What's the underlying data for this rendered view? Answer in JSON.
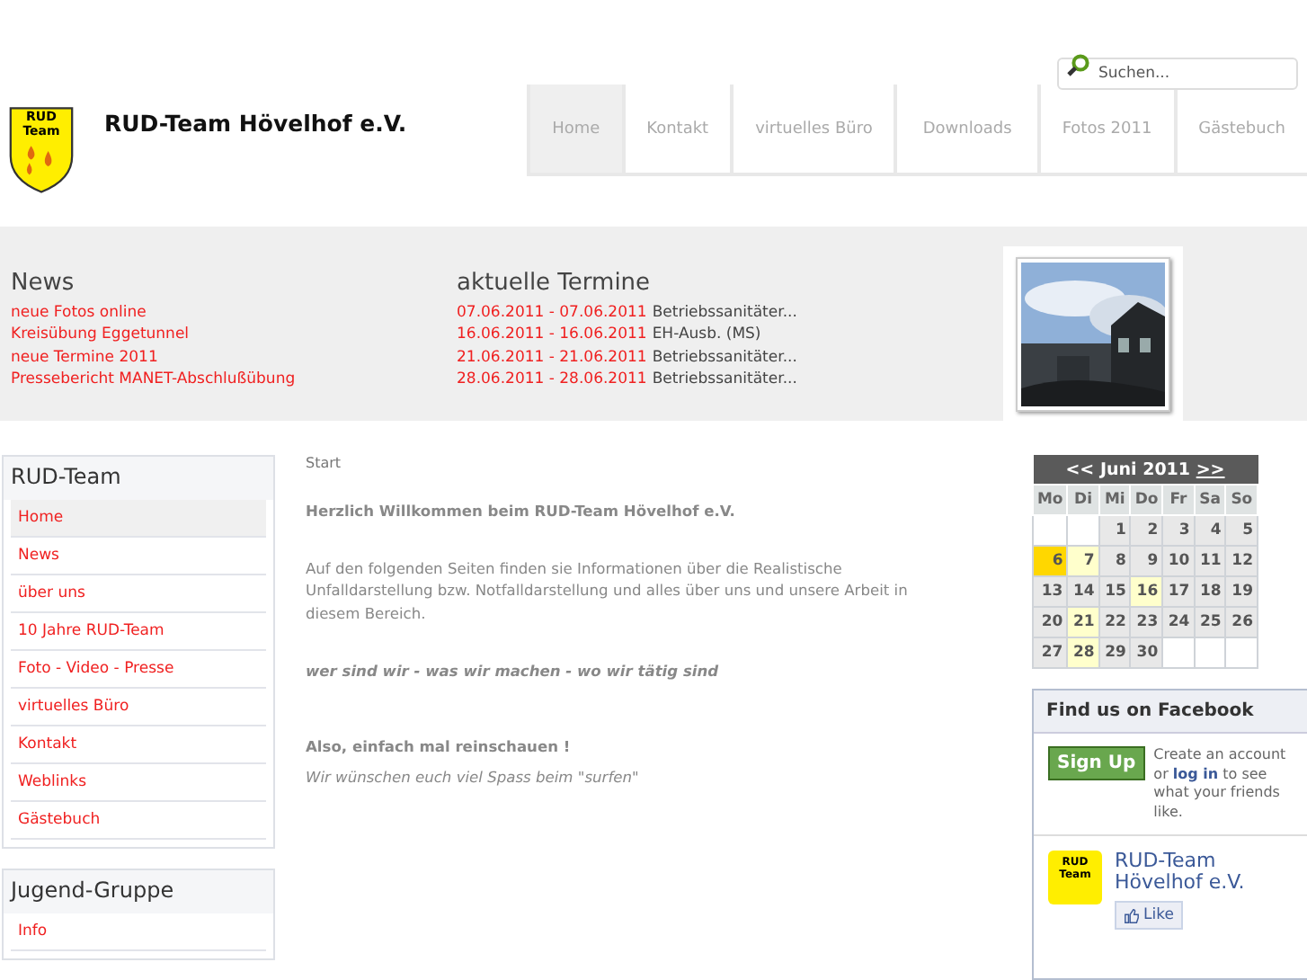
{
  "search": {
    "placeholder": "Suchen..."
  },
  "site_title": "RUD-Team Hövelhof e.V.",
  "logo": {
    "line_1": "RUD",
    "line_2": "Team"
  },
  "nav": [
    {
      "label": "Home",
      "selected": true
    },
    {
      "label": "Kontakt",
      "selected": false
    },
    {
      "label": "virtuelles Büro",
      "selected": false
    },
    {
      "label": "Downloads",
      "selected": false
    },
    {
      "label": "Fotos 2011",
      "selected": false
    },
    {
      "label": "Gästebuch",
      "selected": false
    }
  ],
  "news": {
    "title": "News",
    "items": [
      "neue Fotos online",
      "Kreisübung Eggetunnel",
      "neue Termine 2011",
      "Pressebericht MANET-Abschlußübung"
    ]
  },
  "events": {
    "title": "aktuelle Termine",
    "items": [
      {
        "date": "07.06.2011 - 07.06.2011",
        "name": "Betriebssanitäter..."
      },
      {
        "date": "16.06.2011 - 16.06.2011",
        "name": "EH-Ausb. (MS)"
      },
      {
        "date": "21.06.2011 - 21.06.2011",
        "name": "Betriebssanitäter..."
      },
      {
        "date": "28.06.2011 - 28.06.2011",
        "name": "Betriebssanitäter..."
      }
    ]
  },
  "sidebar": [
    {
      "title": "RUD-Team",
      "items": [
        {
          "label": "Home",
          "selected": true
        },
        {
          "label": "News",
          "selected": false
        },
        {
          "label": "über uns",
          "selected": false
        },
        {
          "label": "10 Jahre RUD-Team",
          "selected": false
        },
        {
          "label": "Foto - Video - Presse",
          "selected": false
        },
        {
          "label": "virtuelles Büro",
          "selected": false
        },
        {
          "label": "Kontakt",
          "selected": false
        },
        {
          "label": "Weblinks",
          "selected": false
        },
        {
          "label": "Gästebuch",
          "selected": false
        }
      ]
    },
    {
      "title": "Jugend-Gruppe",
      "items": [
        {
          "label": "Info",
          "selected": false
        }
      ]
    }
  ],
  "breadcrumb": "Start",
  "content": [
    {
      "kind": "bold",
      "text": "Herzlich Willkommen beim RUD-Team Hövelhof e.V."
    },
    {
      "kind": "normal",
      "text": "Auf den folgenden Seiten finden sie Informationen über die Realistische Unfalldarstellung bzw. Notfalldarstellung und  alles über uns und unsere Arbeit in diesem Bereich."
    },
    {
      "kind": "bold_italic",
      "text": "wer sind wir  -  was wir machen - wo wir tätig sind"
    },
    {
      "kind": "bold",
      "text": "Also, einfach mal reinschauen !"
    },
    {
      "kind": "italic",
      "text": "Wir wünschen euch viel Spass beim \"surfen\""
    }
  ],
  "calendar": {
    "prev": "<<",
    "month": "Juni 2011",
    "next": ">>",
    "weekdays": [
      "Mo",
      "Di",
      "Mi",
      "Do",
      "Fr",
      "Sa",
      "So"
    ],
    "weeks": [
      [
        {
          "kind": "empty"
        },
        {
          "kind": "empty"
        },
        {
          "kind": "normal",
          "day": "1"
        },
        {
          "kind": "normal",
          "day": "2"
        },
        {
          "kind": "normal",
          "day": "3"
        },
        {
          "kind": "normal",
          "day": "4"
        },
        {
          "kind": "normal",
          "day": "5"
        }
      ],
      [
        {
          "kind": "today",
          "day": "6"
        },
        {
          "kind": "event",
          "day": "7"
        },
        {
          "kind": "normal",
          "day": "8"
        },
        {
          "kind": "normal",
          "day": "9"
        },
        {
          "kind": "normal",
          "day": "10"
        },
        {
          "kind": "normal",
          "day": "11"
        },
        {
          "kind": "normal",
          "day": "12"
        }
      ],
      [
        {
          "kind": "normal",
          "day": "13"
        },
        {
          "kind": "normal",
          "day": "14"
        },
        {
          "kind": "normal",
          "day": "15"
        },
        {
          "kind": "event",
          "day": "16"
        },
        {
          "kind": "normal",
          "day": "17"
        },
        {
          "kind": "normal",
          "day": "18"
        },
        {
          "kind": "normal",
          "day": "19"
        }
      ],
      [
        {
          "kind": "normal",
          "day": "20"
        },
        {
          "kind": "event",
          "day": "21"
        },
        {
          "kind": "normal",
          "day": "22"
        },
        {
          "kind": "normal",
          "day": "23"
        },
        {
          "kind": "normal",
          "day": "24"
        },
        {
          "kind": "normal",
          "day": "25"
        },
        {
          "kind": "normal",
          "day": "26"
        }
      ],
      [
        {
          "kind": "normal",
          "day": "27"
        },
        {
          "kind": "event",
          "day": "28"
        },
        {
          "kind": "normal",
          "day": "29"
        },
        {
          "kind": "normal",
          "day": "30"
        },
        {
          "kind": "empty"
        },
        {
          "kind": "empty"
        },
        {
          "kind": "empty"
        }
      ]
    ]
  },
  "facebook": {
    "title": "Find us on Facebook",
    "signup": "Sign Up",
    "text_before": "Create an account or",
    "link": "log in",
    "text_after": "to see what your friends like.",
    "avatar_line_1": "RUD",
    "avatar_line_2": "Team",
    "page_name": "RUD-Team Hövelhof e.V.",
    "like": "Like"
  }
}
